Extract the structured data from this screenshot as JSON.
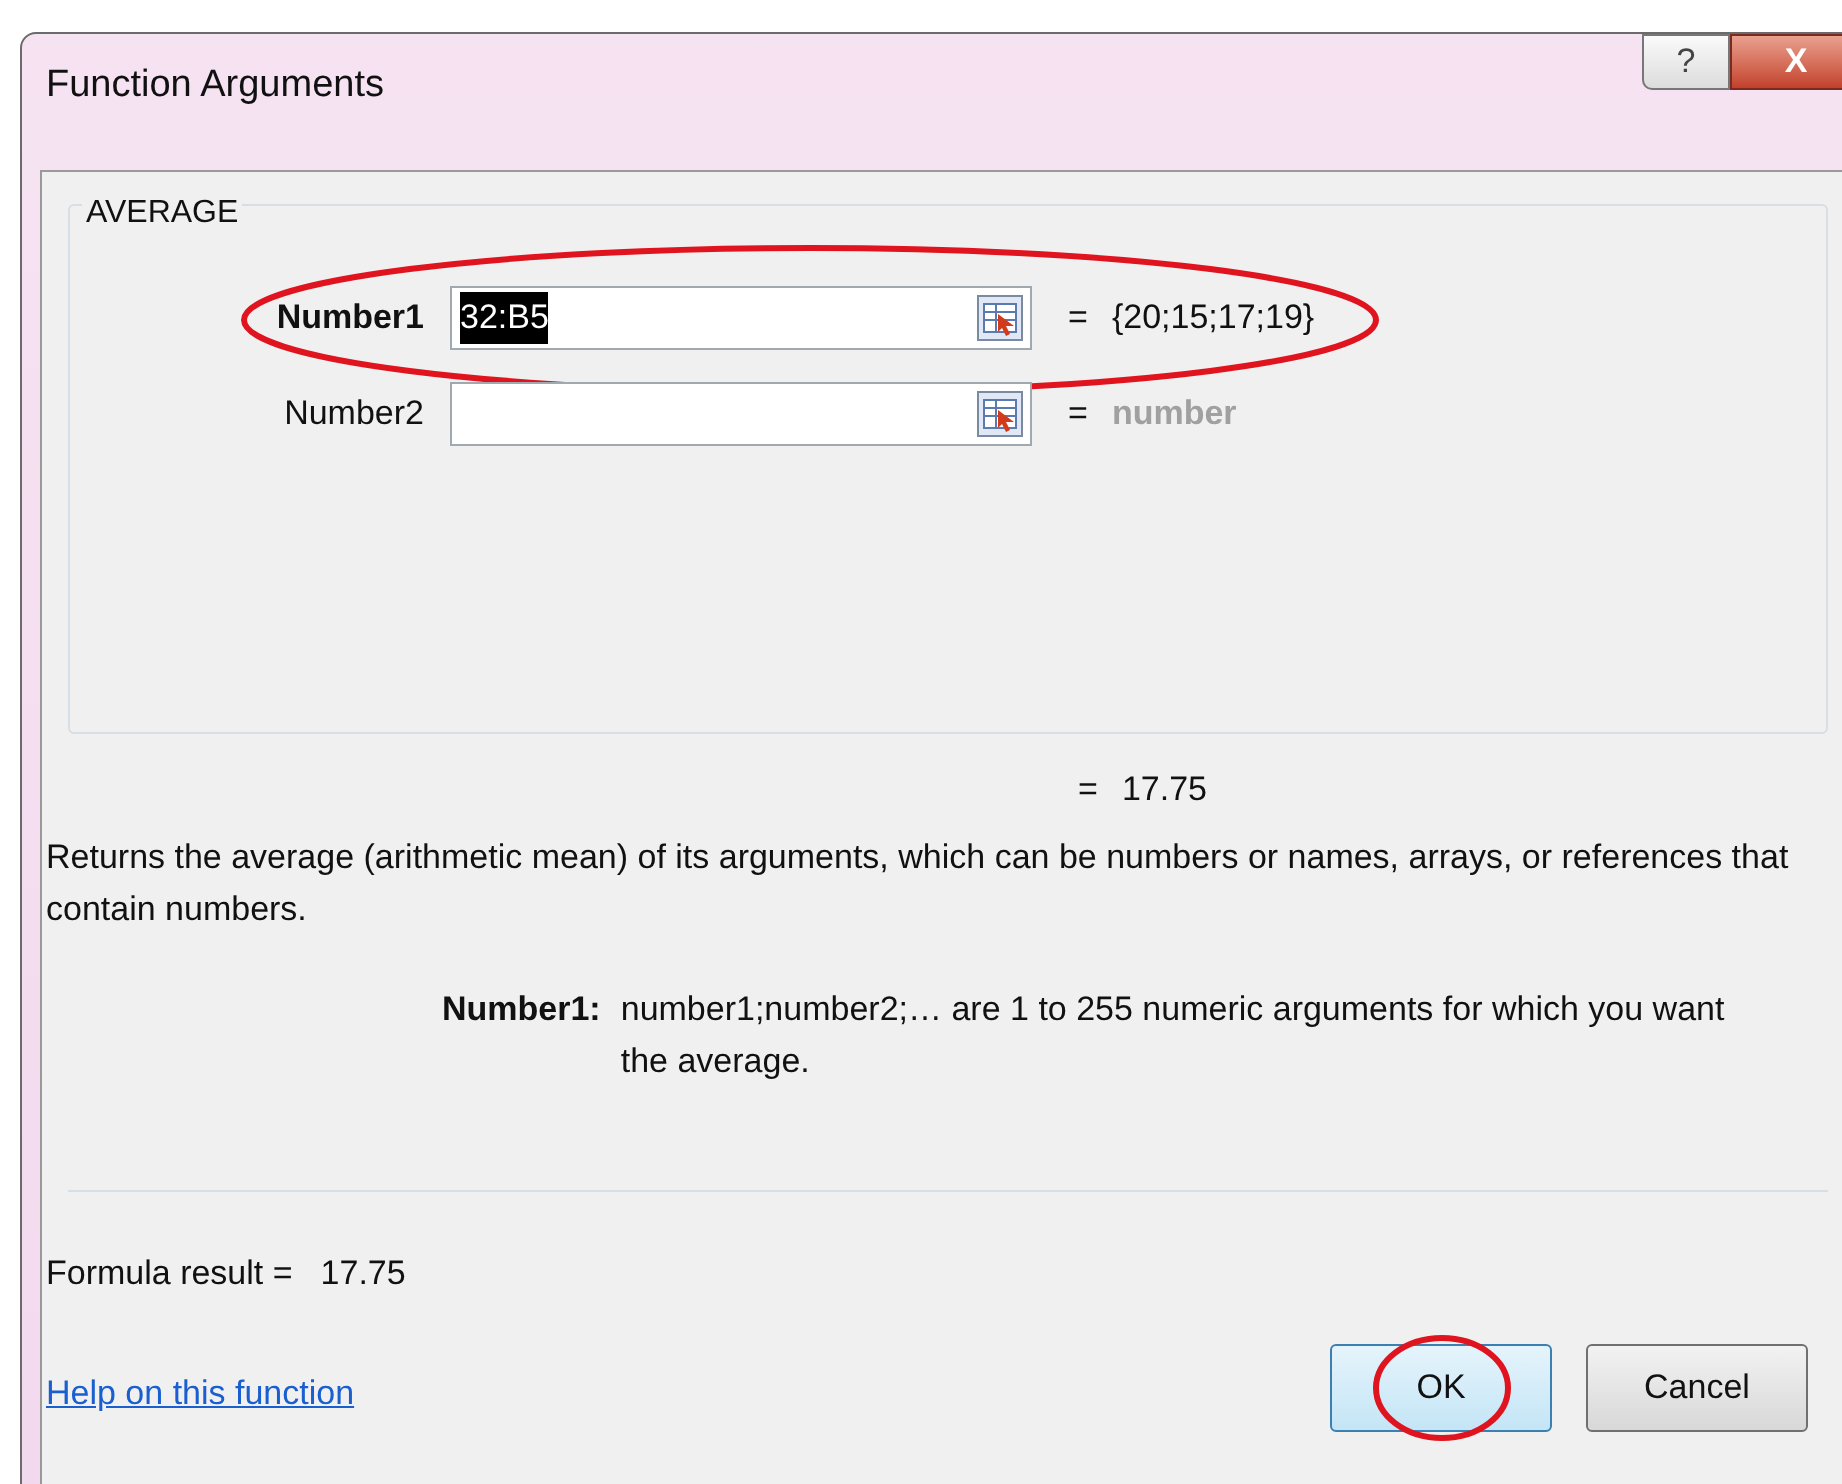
{
  "window": {
    "title": "Function Arguments",
    "help_button": "?",
    "close_button": "X"
  },
  "function_name": "AVERAGE",
  "arguments": [
    {
      "label": "Number1",
      "value": "32:B5",
      "value_selected": true,
      "active": true,
      "equals": "=",
      "result": "{20;15;17;19}",
      "result_is_hint": false,
      "circled": true
    },
    {
      "label": "Number2",
      "value_selected": false,
      "active": false,
      "equals": "=",
      "result": "number",
      "result_is_hint": true,
      "circled": false
    }
  ],
  "function_result": {
    "equals": "=",
    "value": "17.75"
  },
  "description": "Returns the average (arithmetic mean) of its arguments, which can be numbers or names, arrays, or references that contain numbers.",
  "argument_help": {
    "label": "Number1:",
    "text": "number1;number2;… are 1 to 255 numeric arguments for which you want the average."
  },
  "formula_result": {
    "label": "Formula result =",
    "value": "17.75"
  },
  "help_link": "Help on this function",
  "buttons": [
    {
      "label": "OK",
      "default": true,
      "circled": true
    },
    {
      "label": "Cancel",
      "default": false,
      "circled": false
    }
  ]
}
